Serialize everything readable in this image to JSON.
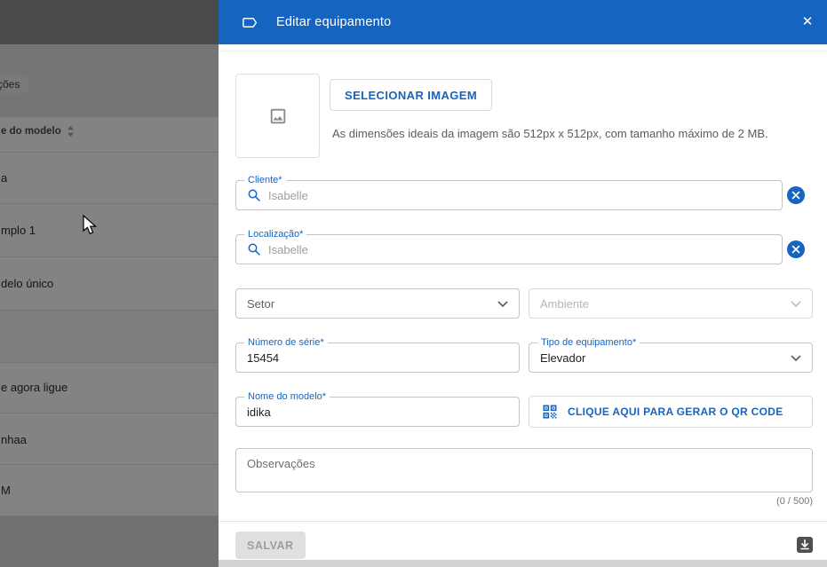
{
  "colors": {
    "primary": "#1565c0"
  },
  "modal": {
    "title": "Editar equipamento",
    "close_glyph": "✕"
  },
  "image_section": {
    "select_button_label": "SELECIONAR IMAGEM",
    "helper_text": "As dimensões ideais da imagem são 512px x 512px, com tamanho máximo de 2 MB."
  },
  "fields": {
    "cliente_label": "Cliente*",
    "cliente_value": "Isabelle",
    "localizacao_label": "Localização*",
    "localizacao_value": "Isabelle",
    "setor_label": "Setor",
    "ambiente_label": "Ambiente",
    "numero_serie_label": "Número de série*",
    "numero_serie_value": "15454",
    "tipo_label": "Tipo de equipamento*",
    "tipo_value": "Elevador",
    "nome_modelo_label": "Nome do modelo*",
    "nome_modelo_value": "idika",
    "qr_button_label": "CLIQUE AQUI PARA GERAR O QR CODE",
    "observacoes_label": "Observações",
    "observacoes_counter": "(0 / 500)"
  },
  "footer": {
    "save_label": "SALVAR"
  },
  "background": {
    "chip_label": "ções",
    "column_header": "e do modelo",
    "rows": [
      "a",
      "mplo 1",
      "delo único",
      "e agora ligue",
      "nhaa",
      "M"
    ]
  }
}
